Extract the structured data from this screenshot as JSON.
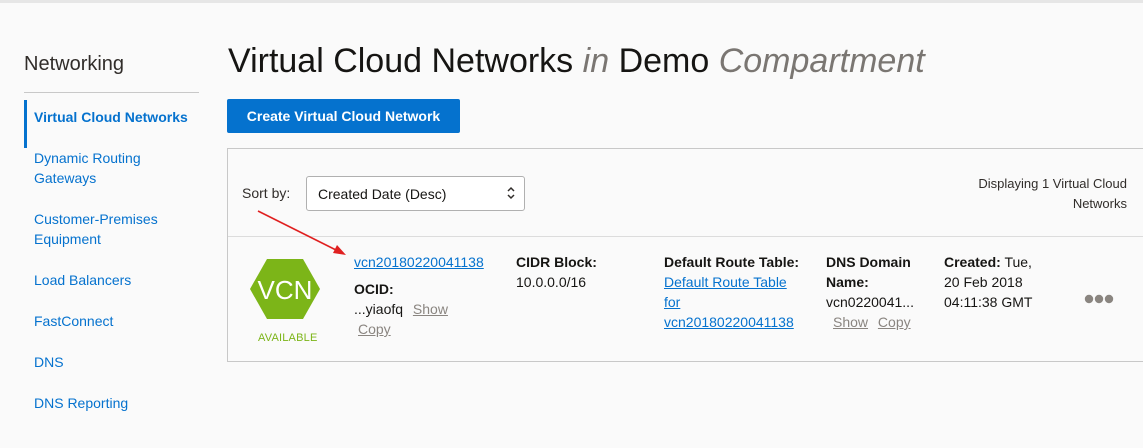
{
  "sidebar": {
    "title": "Networking",
    "items": [
      {
        "label": "Virtual Cloud Networks",
        "active": true
      },
      {
        "label": "Dynamic Routing Gateways"
      },
      {
        "label": "Customer-Premises Equipment"
      },
      {
        "label": "Load Balancers"
      },
      {
        "label": "FastConnect"
      },
      {
        "label": "DNS"
      },
      {
        "label": "DNS Reporting"
      }
    ]
  },
  "header": {
    "title_main": "Virtual Cloud Networks",
    "title_in": "in",
    "title_compartment": "Demo",
    "title_suffix": "Compartment"
  },
  "toolbar": {
    "create_label": "Create Virtual Cloud Network"
  },
  "list": {
    "sort_label": "Sort by:",
    "sort_value": "Created Date (Desc)",
    "display_count": "Displaying 1 Virtual Cloud Networks"
  },
  "vcn": {
    "icon_text": "VCN",
    "status": "AVAILABLE",
    "name": "vcn20180220041138",
    "ocid_label": "OCID:",
    "ocid_value": "...yiaofq",
    "show_label": "Show",
    "copy_label": "Copy",
    "cidr_label": "CIDR Block:",
    "cidr_value": "10.0.0.0/16",
    "route_label": "Default Route Table:",
    "route_value": "Default Route Table for vcn20180220041138",
    "dns_label": "DNS Domain Name:",
    "dns_value": "vcn0220041...",
    "created_label": "Created:",
    "created_value": "Tue, 20 Feb 2018 04:11:38 GMT"
  },
  "colors": {
    "accent": "#0572ce",
    "status_available": "#7cb518",
    "annotation_arrow": "#e02020"
  },
  "icons": [
    "vcn-hexagon-icon",
    "chevron-updown-icon",
    "more-actions-icon"
  ]
}
